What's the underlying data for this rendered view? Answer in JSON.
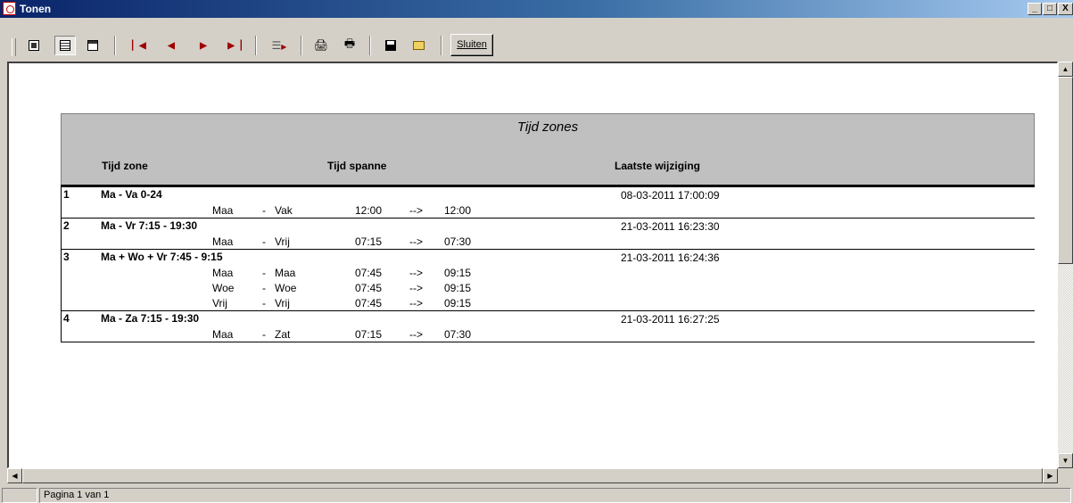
{
  "window": {
    "title": "Tonen",
    "btn_min": "_",
    "btn_max": "□",
    "btn_close": "X"
  },
  "toolbar": {
    "close_label": "Sluiten"
  },
  "report": {
    "title": "Tijd zones",
    "columns": {
      "zone": "Tijd zone",
      "span": "Tijd spanne",
      "changed": "Laatste wijziging"
    },
    "groups": [
      {
        "num": "1",
        "name": "Ma - Va 0-24",
        "date": "08-03-2011 17:00:09",
        "spans": [
          {
            "from": "Maa",
            "sep": "-",
            "to": "Vak",
            "start": "12:00",
            "arrow": "-->",
            "end": "12:00"
          }
        ]
      },
      {
        "num": "2",
        "name": "Ma - Vr 7:15 - 19:30",
        "date": "21-03-2011 16:23:30",
        "spans": [
          {
            "from": "Maa",
            "sep": "-",
            "to": "Vrij",
            "start": "07:15",
            "arrow": "-->",
            "end": "07:30"
          }
        ]
      },
      {
        "num": "3",
        "name": "Ma + Wo + Vr 7:45 - 9:15",
        "date": "21-03-2011 16:24:36",
        "spans": [
          {
            "from": "Maa",
            "sep": "-",
            "to": "Maa",
            "start": "07:45",
            "arrow": "-->",
            "end": "09:15"
          },
          {
            "from": "Woe",
            "sep": "-",
            "to": "Woe",
            "start": "07:45",
            "arrow": "-->",
            "end": "09:15"
          },
          {
            "from": "Vrij",
            "sep": "-",
            "to": "Vrij",
            "start": "07:45",
            "arrow": "-->",
            "end": "09:15"
          }
        ]
      },
      {
        "num": "4",
        "name": "Ma - Za 7:15 - 19:30",
        "date": "21-03-2011 16:27:25",
        "spans": [
          {
            "from": "Maa",
            "sep": "-",
            "to": "Zat",
            "start": "07:15",
            "arrow": "-->",
            "end": "07:30"
          }
        ]
      }
    ]
  },
  "status": {
    "page": "Pagina 1 van 1"
  },
  "icons": [
    "app-icon",
    "one-page-icon",
    "full-page-icon",
    "multi-page-icon",
    "first-page-icon",
    "previous-page-icon",
    "next-page-icon",
    "last-page-icon",
    "goto-page-icon",
    "print-setup-icon",
    "print-icon",
    "save-icon",
    "open-icon"
  ]
}
